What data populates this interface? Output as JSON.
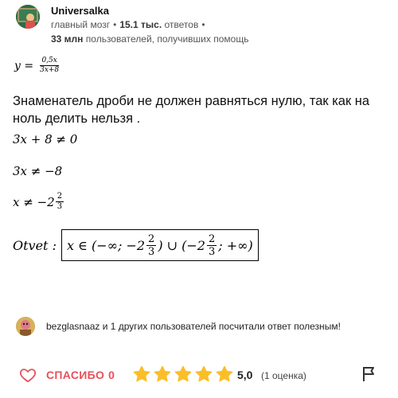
{
  "author": {
    "name": "Universalka",
    "rank": "главный мозг",
    "answers_count": "15.1 тыс.",
    "answers_label": "ответов",
    "helped_count": "33 млн",
    "helped_label": "пользователей, получивших помощь"
  },
  "answer": {
    "function_lhs": "y =",
    "function_num": "0,5x",
    "function_den": "3x+8",
    "explanation": "Знаменатель дроби не должен равняться нулю, так как на ноль делить нельзя .",
    "step1": "3x + 8 ≠ 0",
    "step2": "3x ≠ −8",
    "step3_prefix": "x ≠ −2",
    "step3_num": "2",
    "step3_den": "3",
    "otvet_label": "Otvet :",
    "interval_prefix": "x ∈ (−∞; −2",
    "interval_num1": "2",
    "interval_den1": "3",
    "interval_mid": ") ∪ (−2",
    "interval_num2": "2",
    "interval_den2": "3",
    "interval_suffix": "; +∞)"
  },
  "helpful": {
    "text": "bezglasnaaz и 1 других пользователей посчитали ответ полезным!"
  },
  "footer": {
    "thanks_label": "СПАСИБО",
    "thanks_count": "0",
    "rating_value": "5,0",
    "rating_count": "(1 оценка)",
    "stars_filled": 5,
    "stars_total": 5,
    "star_color": "#fbbe28",
    "heart_color": "#e8505b"
  }
}
